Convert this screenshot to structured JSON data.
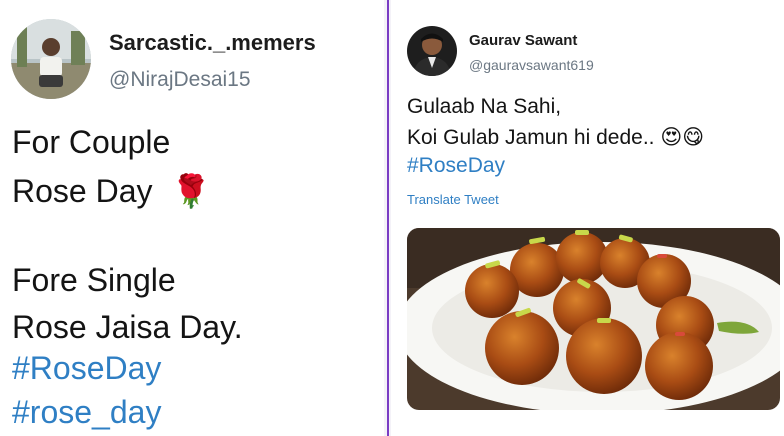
{
  "left_tweet": {
    "display_name": "Sarcastic._.memers",
    "handle": "@NirajDesai15",
    "lines": [
      "For Couple",
      "Rose Day",
      "Fore Single",
      "Rose Jaisa Day."
    ],
    "hashtags": [
      "#RoseDay",
      "#rose_day"
    ],
    "emoji": "🌹"
  },
  "right_tweet": {
    "display_name": "Gaurav Sawant",
    "handle": "@gauravsawant619",
    "lines": [
      "Gulaab Na Sahi,",
      "Koi Gulab Jamun hi dede.."
    ],
    "emoji": "😍😋",
    "hashtag": "#RoseDay",
    "translate_label": "Translate Tweet"
  },
  "colors": {
    "hashtag": "#2f7fc4",
    "divider": "#7a3cc4",
    "handle": "#6b7783"
  },
  "icons": {
    "avatar_left": "person-photo",
    "avatar_right": "person-photo",
    "photo": "gulab-jamun-plate"
  }
}
